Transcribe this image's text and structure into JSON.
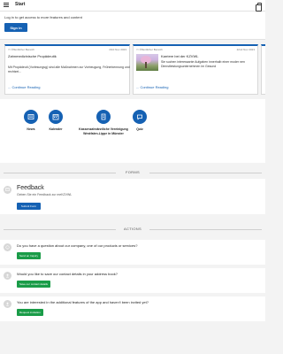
{
  "header": {
    "title": "Start"
  },
  "login": {
    "prompt": "Log in to get access to more features and content",
    "signin_label": "Sign in"
  },
  "news_cards": [
    {
      "category": "▭ Öffentlicher Bereich",
      "date": "23rd Nov 2023",
      "title": "Zahnmedizinische Propädeutik",
      "body": "Mit Propädeuti (Vorlesungsg) sind alle Maßnahmen zur Vorbeugung, Früherkennung und rechtzei...",
      "link": "... Continue Reading"
    },
    {
      "category": "▭ Öffentlicher Bereich",
      "date": "22nd Nov 2023",
      "title": "Karriere bei der KZVWL",
      "body": "Sie suchen interessante Aufgaben innerhalb einer moder nen Dienstleistungsunternehmen im Gesund",
      "link": "... Continue Reading"
    }
  ],
  "quick_links": [
    {
      "label": "News",
      "icon": "news-icon"
    },
    {
      "label": "Kalender",
      "icon": "calendar-icon"
    },
    {
      "label": "Kassenzahnärztliche Vereinigung Westfalen-Lippe in Münster",
      "icon": "building-icon"
    },
    {
      "label": "Quiz",
      "icon": "quiz-icon"
    }
  ],
  "forms_section": {
    "label": "FORMS"
  },
  "feedback": {
    "title": "Feedback",
    "subtitle": "Geben Sie ein Feedback zur meKZVWL",
    "button": "Submit Form"
  },
  "actions_section": {
    "label": "ACTIONS"
  },
  "actions": [
    {
      "text": "Do you have a question about our company, one of our products or services?",
      "button": "Send an Inquiry"
    },
    {
      "text": "Would you like to save our contact details in your address book?",
      "button": "Save our contact details"
    },
    {
      "text": "You are interested in the additional features of the app and haven't been invited yet?",
      "button": "Request invitation"
    }
  ],
  "colors": {
    "primary": "#1561b3",
    "action": "#1a9c48",
    "background": "#f3f3f3"
  }
}
